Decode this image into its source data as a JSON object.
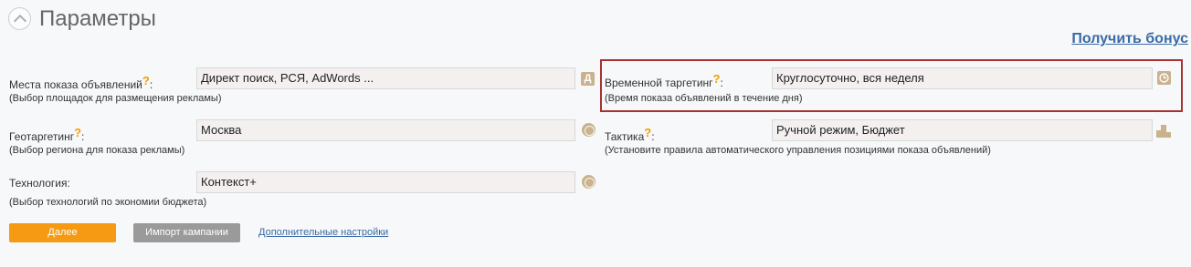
{
  "header": {
    "title": "Параметры",
    "bonus_link": "Получить бонус"
  },
  "left": [
    {
      "label": "Места показа объявлений",
      "hint": "(Выбор площадок для размещения рекламы)",
      "value": "Директ поиск, РСЯ, AdWords ...",
      "icon": "direct-icon",
      "icon_glyph": "Д"
    },
    {
      "label": "Геотаргетинг",
      "hint": "(Выбор региона для показа рекламы)",
      "value": "Москва",
      "icon": "globe-icon"
    },
    {
      "label": "Технология:",
      "hint": "(Выбор технологий по экономии бюджета)",
      "value": "Контекст+",
      "icon": "globe-icon"
    }
  ],
  "right": [
    {
      "label": "Временной таргетинг",
      "hint": "(Время показа объявлений в течение дня)",
      "value": "Круглосуточно, вся неделя",
      "icon": "clock-icon"
    },
    {
      "label": "Тактика",
      "hint": "(Установите правила автоматического управления позициями показа объявлений)",
      "value": "Ручной режим, Бюджет",
      "icon": "podium-icon"
    }
  ],
  "help_mark": "?",
  "colon": ":",
  "buttons": {
    "next": "Далее",
    "import": "Импорт кампании",
    "more_settings": "Дополнительные настройки"
  },
  "colors": {
    "accent": "#f59a12",
    "link": "#3a6aa6",
    "highlight": "#a83232"
  }
}
